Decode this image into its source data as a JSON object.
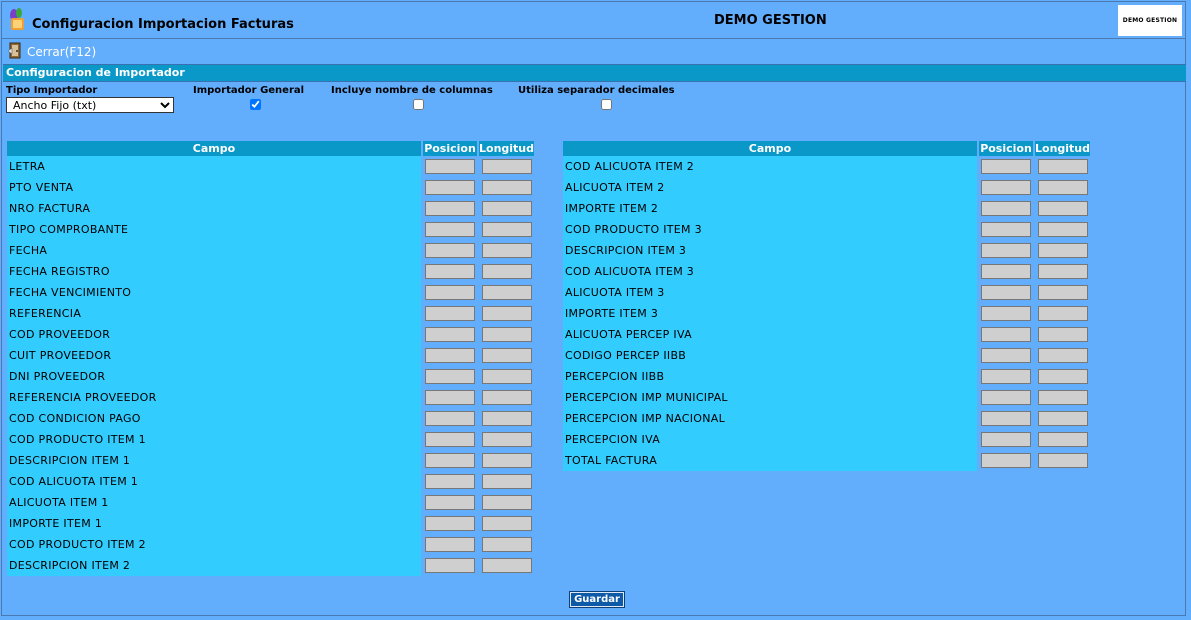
{
  "window": {
    "title": "Configuracion Importacion Facturas",
    "company": "DEMO GESTION",
    "logo_text": "DEMO GESTION"
  },
  "toolbar": {
    "close_label": "Cerrar(F12)"
  },
  "section": {
    "title": "Configuracion de Importador"
  },
  "options": {
    "tipo_label": "Tipo Importador",
    "tipo_value": "Ancho Fijo (txt)",
    "general_label": "Importador General",
    "general_checked": true,
    "incluye_label": "Incluye nombre de columnas",
    "incluye_checked": false,
    "separador_label": "Utiliza separador decimales",
    "separador_checked": false
  },
  "grid_headers": {
    "campo": "Campo",
    "posicion": "Posicion",
    "longitud": "Longitud"
  },
  "left_fields": [
    "LETRA",
    "PTO VENTA",
    "NRO FACTURA",
    "TIPO COMPROBANTE",
    "FECHA",
    "FECHA REGISTRO",
    "FECHA VENCIMIENTO",
    "REFERENCIA",
    "COD PROVEEDOR",
    "CUIT PROVEEDOR",
    "DNI PROVEEDOR",
    "REFERENCIA PROVEEDOR",
    "COD CONDICION PAGO",
    "COD PRODUCTO ITEM 1",
    "DESCRIPCION ITEM 1",
    "COD ALICUOTA ITEM 1",
    "ALICUOTA ITEM 1",
    "IMPORTE ITEM 1",
    "COD PRODUCTO ITEM 2",
    "DESCRIPCION ITEM 2"
  ],
  "right_fields": [
    "COD ALICUOTA ITEM 2",
    "ALICUOTA ITEM 2",
    "IMPORTE ITEM 2",
    "COD PRODUCTO ITEM 3",
    "DESCRIPCION ITEM 3",
    "COD ALICUOTA ITEM 3",
    "ALICUOTA ITEM 3",
    "IMPORTE ITEM 3",
    "ALICUOTA PERCEP IVA",
    "CODIGO PERCEP IIBB",
    "PERCEPCION IIBB",
    "PERCEPCION IMP MUNICIPAL",
    "PERCEPCION IMP NACIONAL",
    "PERCEPCION IVA",
    "TOTAL FACTURA"
  ],
  "actions": {
    "save_label": "Guardar"
  },
  "colors": {
    "background": "#63aefc",
    "header_bar": "#0a98c8",
    "field_cell": "#33ccff",
    "save_button": "#0d5aa8"
  }
}
